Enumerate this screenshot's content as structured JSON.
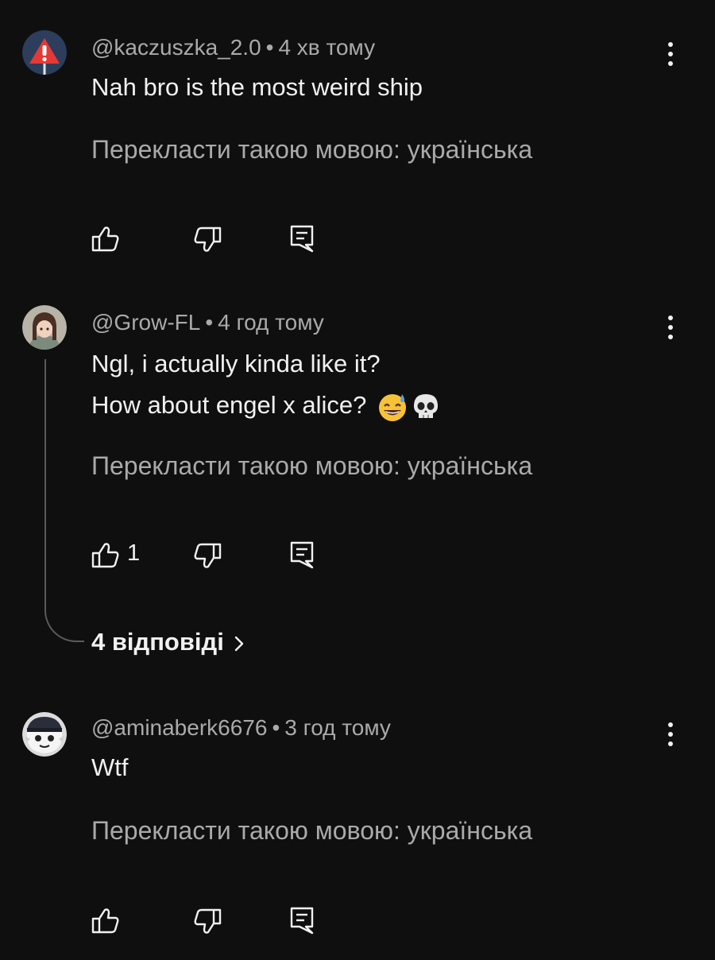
{
  "comments": [
    {
      "username": "@kaczuszka_2.0",
      "time": "4 хв тому",
      "lines": [
        "Nah bro is the most weird ship"
      ],
      "translate": "Перекласти такою мовою: українська",
      "likes": ""
    },
    {
      "username": "@Grow-FL",
      "time": "4 год тому",
      "lines": [
        "Ngl, i actually kinda like it?",
        "How about engel x alice?"
      ],
      "translate": "Перекласти такою мовою: українська",
      "likes": "1",
      "replies_label": "4 відповіді"
    },
    {
      "username": "@aminaberk6676",
      "time": "3 год тому",
      "lines": [
        "Wtf"
      ],
      "translate": "Перекласти такою мовою: українська",
      "likes": ""
    }
  ],
  "separator": "•",
  "icons": {
    "like": "thumbs-up-icon",
    "dislike": "thumbs-down-icon",
    "reply": "reply-comment-icon",
    "more": "more-vertical-icon",
    "chevron": "chevron-right-icon",
    "emoji_1": "grinning-face-with-sweat-emoji",
    "emoji_2": "skull-emoji"
  },
  "colors": {
    "background": "#0f0f0f",
    "text": "#f1f1f1",
    "secondary_text": "#aaaaaa",
    "thread_line": "#5a5a5a"
  }
}
